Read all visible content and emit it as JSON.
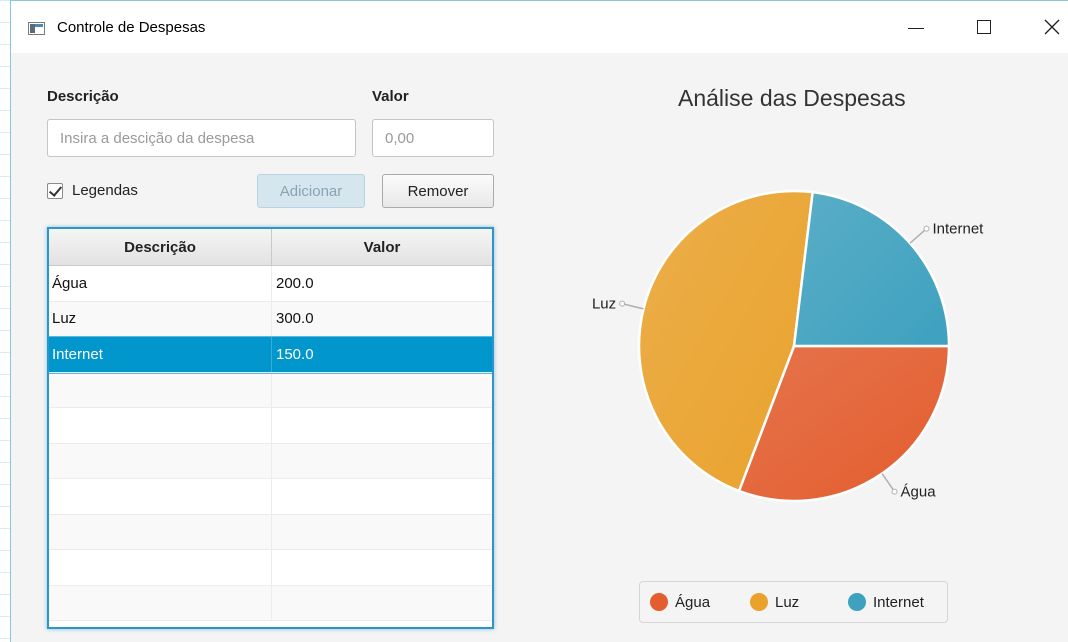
{
  "window": {
    "title": "Controle de Despesas",
    "controls": [
      "minimize-icon",
      "maximize-icon",
      "close-icon"
    ]
  },
  "form": {
    "descricao_label": "Descrição",
    "valor_label": "Valor",
    "descricao_placeholder": "Insira a descição da despesa",
    "descricao_value": "",
    "valor_placeholder": "0,00",
    "valor_value": "",
    "legendas_label": "Legendas",
    "legendas_checked": true,
    "add_label": "Adicionar",
    "add_enabled": false,
    "remove_label": "Remover"
  },
  "table": {
    "columns": [
      "Descrição",
      "Valor"
    ],
    "rows": [
      {
        "descricao": "Água",
        "valor": "200.0"
      },
      {
        "descricao": "Luz",
        "valor": "300.0"
      },
      {
        "descricao": "Internet",
        "valor": "150.0"
      }
    ],
    "selected_index": 2
  },
  "chart_data": {
    "type": "pie",
    "title": "Análise das Despesas",
    "slices": [
      {
        "label": "Água",
        "value": 200,
        "color": "#e35d2e"
      },
      {
        "label": "Luz",
        "value": 300,
        "color": "#eaa22c"
      },
      {
        "label": "Internet",
        "value": 150,
        "color": "#3ea1bf"
      }
    ],
    "legend": [
      "Água",
      "Luz",
      "Internet"
    ],
    "legend_position": "bottom",
    "labels_visible": true
  },
  "colors": {
    "accent": "#0196cc",
    "disabled_button": "#d5e6ef"
  }
}
